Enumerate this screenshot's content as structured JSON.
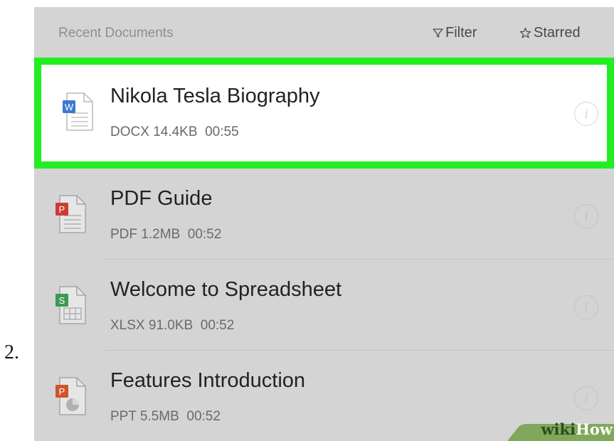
{
  "step_number": "2.",
  "header": {
    "title": "Recent Documents",
    "filter_label": "Filter",
    "filter_icon": "filter-funnel-icon",
    "starred_label": "Starred",
    "starred_icon": "star-outline-icon"
  },
  "documents": [
    {
      "name": "Nikola Tesla Biography",
      "type": "DOCX",
      "size": "14.4KB",
      "time": "00:55",
      "icon": "word-document-icon",
      "badge_letter": "W",
      "badge_color": "#3b7ad1",
      "highlighted": true
    },
    {
      "name": "PDF Guide",
      "type": "PDF",
      "size": "1.2MB",
      "time": "00:52",
      "icon": "pdf-document-icon",
      "badge_letter": "P",
      "badge_color": "#cc3a34",
      "highlighted": false
    },
    {
      "name": "Welcome to Spreadsheet",
      "type": "XLSX",
      "size": "91.0KB",
      "time": "00:52",
      "icon": "spreadsheet-document-icon",
      "badge_letter": "S",
      "badge_color": "#3b9a52",
      "highlighted": false
    },
    {
      "name": "Features Introduction",
      "type": "PPT",
      "size": "5.5MB",
      "time": "00:52",
      "icon": "presentation-document-icon",
      "badge_letter": "P",
      "badge_color": "#d0542d",
      "highlighted": false
    }
  ],
  "info_icon": "info-icon",
  "info_glyph": "i",
  "highlight_color": "#22ee22",
  "watermark": {
    "wiki": "wiki",
    "how": "How"
  }
}
